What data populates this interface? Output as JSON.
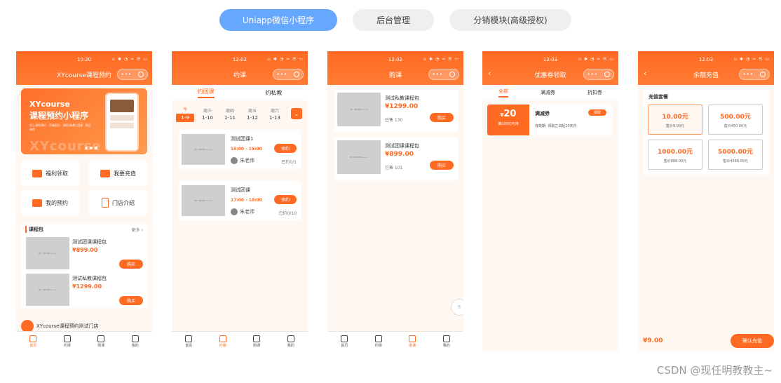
{
  "top_tabs": [
    "Uniapp微信小程序",
    "后台管理",
    "分销模块(高级授权)"
  ],
  "status_signal": "▫ ✱ ◔ ≈ ☰ ▭",
  "capsule": {
    "dots": "•••"
  },
  "bottom_nav": [
    "首页",
    "约课",
    "购课",
    "我的"
  ],
  "phone1": {
    "time": "10:20",
    "title": "XYcourse课程预约",
    "banner": {
      "line1": "XYcourse",
      "line2": "课程预约小程序",
      "line3": "线上课程预约 · 开箱即用 · 课程(私教) 团课 · 购买课程",
      "big": "XYcourse"
    },
    "quick": [
      "福利领取",
      "我要充值",
      "我的预约",
      "门店介绍"
    ],
    "section_title": "课程包",
    "section_more": "更多",
    "courses": [
      {
        "name": "测试团课课程包",
        "price": "¥899.00",
        "buy": "购买"
      },
      {
        "name": "测试私教课程包",
        "price": "¥1299.00",
        "buy": "购买"
      }
    ],
    "thumb_text": "课程 · 课程封面图 300×180",
    "store": "XYcourse课程预约测试门店"
  },
  "phone2": {
    "time": "12:02",
    "title": "约课",
    "tabs": [
      "约团课",
      "约私教"
    ],
    "dates": [
      {
        "w": "今",
        "d": "1-9"
      },
      {
        "w": "周三",
        "d": "1-10"
      },
      {
        "w": "周四",
        "d": "1-11"
      },
      {
        "w": "周五",
        "d": "1-12"
      },
      {
        "w": "周六",
        "d": "1-13"
      }
    ],
    "classes": [
      {
        "name": "测试团课1",
        "time": "15:00 - 16:00",
        "teacher": "朱老师",
        "btn": "预约",
        "booked": "已约0/1"
      },
      {
        "name": "测试团课",
        "time": "17:00 - 18:00",
        "teacher": "朱老师",
        "btn": "预约",
        "booked": "已约0/10"
      }
    ]
  },
  "phone3": {
    "time": "12:02",
    "title": "购课",
    "items": [
      {
        "name": "测试私教课程包",
        "price": "¥1299.00",
        "sold": "已售 130",
        "buy": "购买"
      },
      {
        "name": "测试团课课程包",
        "price": "¥899.00",
        "sold": "已售 101",
        "buy": "购买"
      }
    ]
  },
  "phone4": {
    "time": "12:03",
    "title": "优惠券领取",
    "tabs": [
      "全部",
      "满减券",
      "折扣券"
    ],
    "coupon": {
      "currency": "¥",
      "amount": "20",
      "cond": "满100元可用",
      "name": "满减券",
      "desc": "有效期: 领取之日起10天内",
      "claim": "领取"
    }
  },
  "phone5": {
    "time": "12:03",
    "title": "余额充值",
    "section": "充值套餐",
    "packages": [
      {
        "amount": "10.00元",
        "price": "售价9.00元"
      },
      {
        "amount": "500.00元",
        "price": "售价450.00元"
      },
      {
        "amount": "1000.00元",
        "price": "售价888.00元"
      },
      {
        "amount": "5000.00元",
        "price": "售价4588.00元"
      }
    ],
    "total": "¥9.00",
    "confirm": "确认充值"
  },
  "watermark": "CSDN @现任明教教主~",
  "colors": {
    "accent": "#ff6a22",
    "tab_active": "#66a7ff"
  }
}
